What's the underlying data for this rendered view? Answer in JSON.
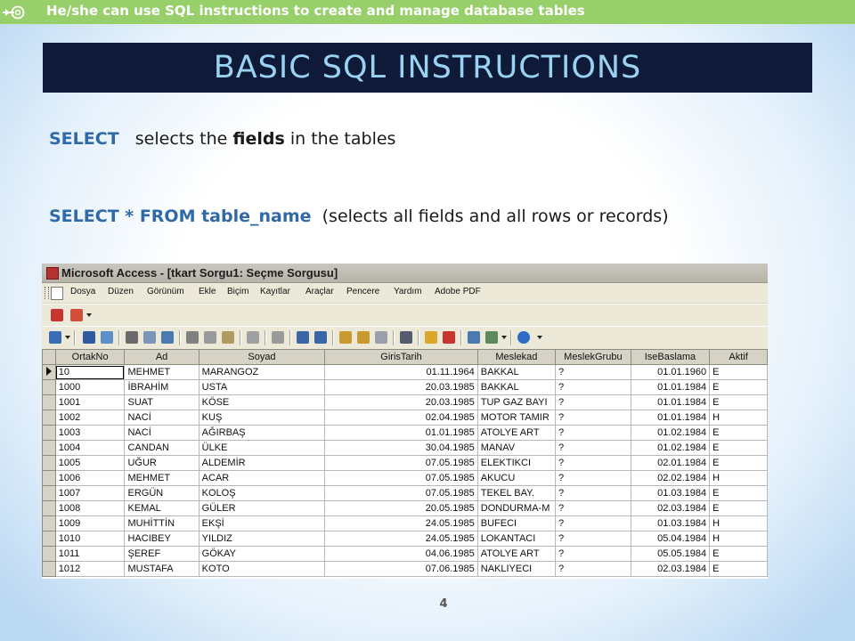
{
  "header": {
    "objective": "He/she can use SQL instructions to create and manage database tables"
  },
  "title": "BASIC SQL INSTRUCTIONS",
  "line1": {
    "keyword": "SELECT",
    "pre": "selects the ",
    "bold": "fields",
    "post": " in the tables"
  },
  "line2": {
    "keyword": "SELECT * FROM table_name",
    "text": "(selects all fields and all rows or records)"
  },
  "window": {
    "title": "Microsoft Access - [tkart Sorgu1: Seçme Sorgusu]",
    "menu": [
      "Dosya",
      "Düzen",
      "Görünüm",
      "Ekle",
      "Biçim",
      "Kayıtlar",
      "Araçlar",
      "Pencere",
      "Yardım",
      "Adobe PDF"
    ]
  },
  "grid": {
    "columns": [
      "OrtakNo",
      "Ad",
      "Soyad",
      "GirisTarih",
      "Meslekad",
      "MeslekGrubu",
      "IseBaslama",
      "Aktif"
    ],
    "rows": [
      [
        "10",
        "MEHMET",
        "MARANGOZ",
        "01.11.1964",
        "BAKKAL",
        "?",
        "01.01.1960",
        "E"
      ],
      [
        "1000",
        "İBRAHİM",
        "USTA",
        "20.03.1985",
        "BAKKAL",
        "?",
        "01.01.1984",
        "E"
      ],
      [
        "1001",
        "SUAT",
        "KÖSE",
        "20.03.1985",
        "TUP GAZ BAYI",
        "?",
        "01.01.1984",
        "E"
      ],
      [
        "1002",
        "NACİ",
        "KUŞ",
        "02.04.1985",
        "MOTOR TAMIR",
        "?",
        "01.01.1984",
        "H"
      ],
      [
        "1003",
        "NACİ",
        "AĞIRBAŞ",
        "01.01.1985",
        "ATOLYE ART",
        "?",
        "01.02.1984",
        "E"
      ],
      [
        "1004",
        "CANDAN",
        "ÜLKE",
        "30.04.1985",
        "MANAV",
        "?",
        "01.02.1984",
        "E"
      ],
      [
        "1005",
        "UĞUR",
        "ALDEMİR",
        "07.05.1985",
        "ELEKTIKCI",
        "?",
        "02.01.1984",
        "E"
      ],
      [
        "1006",
        "MEHMET",
        "ACAR",
        "07.05.1985",
        "AKUCU",
        "?",
        "02.02.1984",
        "H"
      ],
      [
        "1007",
        "ERGÜN",
        "KOLOŞ",
        "07.05.1985",
        "TEKEL BAY.",
        "?",
        "01.03.1984",
        "E"
      ],
      [
        "1008",
        "KEMAL",
        "GÜLER",
        "20.05.1985",
        "DONDURMA-M",
        "?",
        "02.03.1984",
        "E"
      ],
      [
        "1009",
        "MUHİTTİN",
        "EKŞİ",
        "24.05.1985",
        "BUFECI",
        "?",
        "01.03.1984",
        "H"
      ],
      [
        "1010",
        "HACIBEY",
        "YILDIZ",
        "24.05.1985",
        "LOKANTACI",
        "?",
        "05.04.1984",
        "H"
      ],
      [
        "1011",
        "ŞEREF",
        "GÖKAY",
        "04.06.1985",
        "ATOLYE ART",
        "?",
        "05.05.1984",
        "E"
      ],
      [
        "1012",
        "MUSTAFA",
        "KOTO",
        "07.06.1985",
        "NAKLIYECI",
        "?",
        "02.03.1984",
        "E"
      ]
    ]
  },
  "page_number": "4"
}
